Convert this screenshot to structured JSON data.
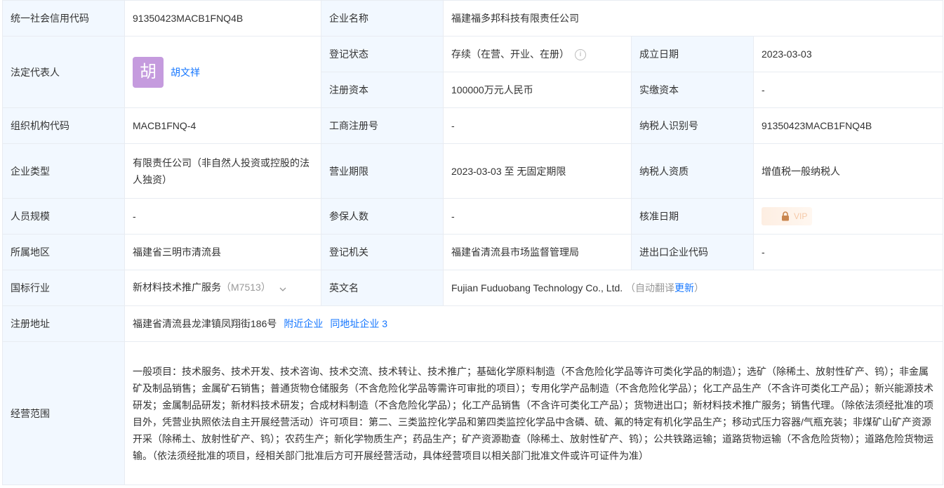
{
  "row1": {
    "credit_code_label": "统一社会信用代码",
    "credit_code": "91350423MACB1FNQ4B",
    "company_name_label": "企业名称",
    "company_name": "福建福多邦科技有限责任公司"
  },
  "legal_rep": {
    "label": "法定代表人",
    "avatar_char": "胡",
    "name": "胡文祥"
  },
  "status": {
    "label": "登记状态",
    "value": "存续（在营、开业、在册）",
    "info_icon": "info-circle-icon",
    "founded_label": "成立日期",
    "founded": "2023-03-03"
  },
  "capital": {
    "registered_label": "注册资本",
    "registered": "100000万元人民币",
    "paid_label": "实缴资本",
    "paid": "-"
  },
  "org": {
    "org_code_label": "组织机构代码",
    "org_code": "MACB1FNQ-4",
    "reg_no_label": "工商注册号",
    "reg_no": "-",
    "taxpayer_id_label": "纳税人识别号",
    "taxpayer_id": "91350423MACB1FNQ4B"
  },
  "type": {
    "label": "企业类型",
    "value": "有限责任公司（非自然人投资或控股的法人独资）",
    "term_label": "营业期限",
    "term": "2023-03-03 至 无固定期限",
    "tax_qual_label": "纳税人资质",
    "tax_qual": "增值税一般纳税人"
  },
  "staff": {
    "label": "人员规模",
    "value": "-",
    "insured_label": "参保人数",
    "insured": "-",
    "approval_label": "核准日期",
    "lock_icon": "lock-icon",
    "vip_text": "VIP"
  },
  "region": {
    "label": "所属地区",
    "value": "福建省三明市清流县",
    "authority_label": "登记机关",
    "authority": "福建省清流县市场监督管理局",
    "ie_code_label": "进出口企业代码",
    "ie_code": "-"
  },
  "industry": {
    "label": "国标行业",
    "value": "新材料技术推广服务",
    "code": "（M7513）",
    "chevron_icon": "chevron-down-icon",
    "en_name_label": "英文名",
    "en_name": "Fujian Fuduobang Technology Co., Ltd.",
    "auto_translate_prefix": "（自动翻译",
    "update_link": "更新",
    "auto_translate_suffix": "）"
  },
  "address": {
    "label": "注册地址",
    "value": "福建省清流县龙津镇凤翔街186号",
    "nearby_link": "附近企业",
    "same_addr_link": "同地址企业 3"
  },
  "scope": {
    "label": "经营范围",
    "value": "一般项目：技术服务、技术开发、技术咨询、技术交流、技术转让、技术推广；基础化学原料制造（不含危险化学品等许可类化学品的制造）；选矿（除稀土、放射性矿产、钨）；非金属矿及制品销售；金属矿石销售；普通货物仓储服务（不含危险化学品等需许可审批的项目）；专用化学产品制造（不含危险化学品）；化工产品生产（不含许可类化工产品）；新兴能源技术研发；金属制品研发；新材料技术研发；合成材料制造（不含危险化学品）；化工产品销售（不含许可类化工产品）；货物进出口；新材料技术推广服务；销售代理。（除依法须经批准的项目外，凭营业执照依法自主开展经营活动）许可项目：第二、三类监控化学品和第四类监控化学品中含磷、硫、氟的特定有机化学品生产；移动式压力容器/气瓶充装；非煤矿山矿产资源开采（除稀土、放射性矿产、钨）；农药生产；新化学物质生产；药品生产；矿产资源勘查（除稀土、放射性矿产、钨）；公共铁路运输；道路货物运输（不含危险货物）；道路危险货物运输。（依法须经批准的项目，经相关部门批准后方可开展经营活动，具体经营项目以相关部门批准文件或许可证件为准）"
  }
}
